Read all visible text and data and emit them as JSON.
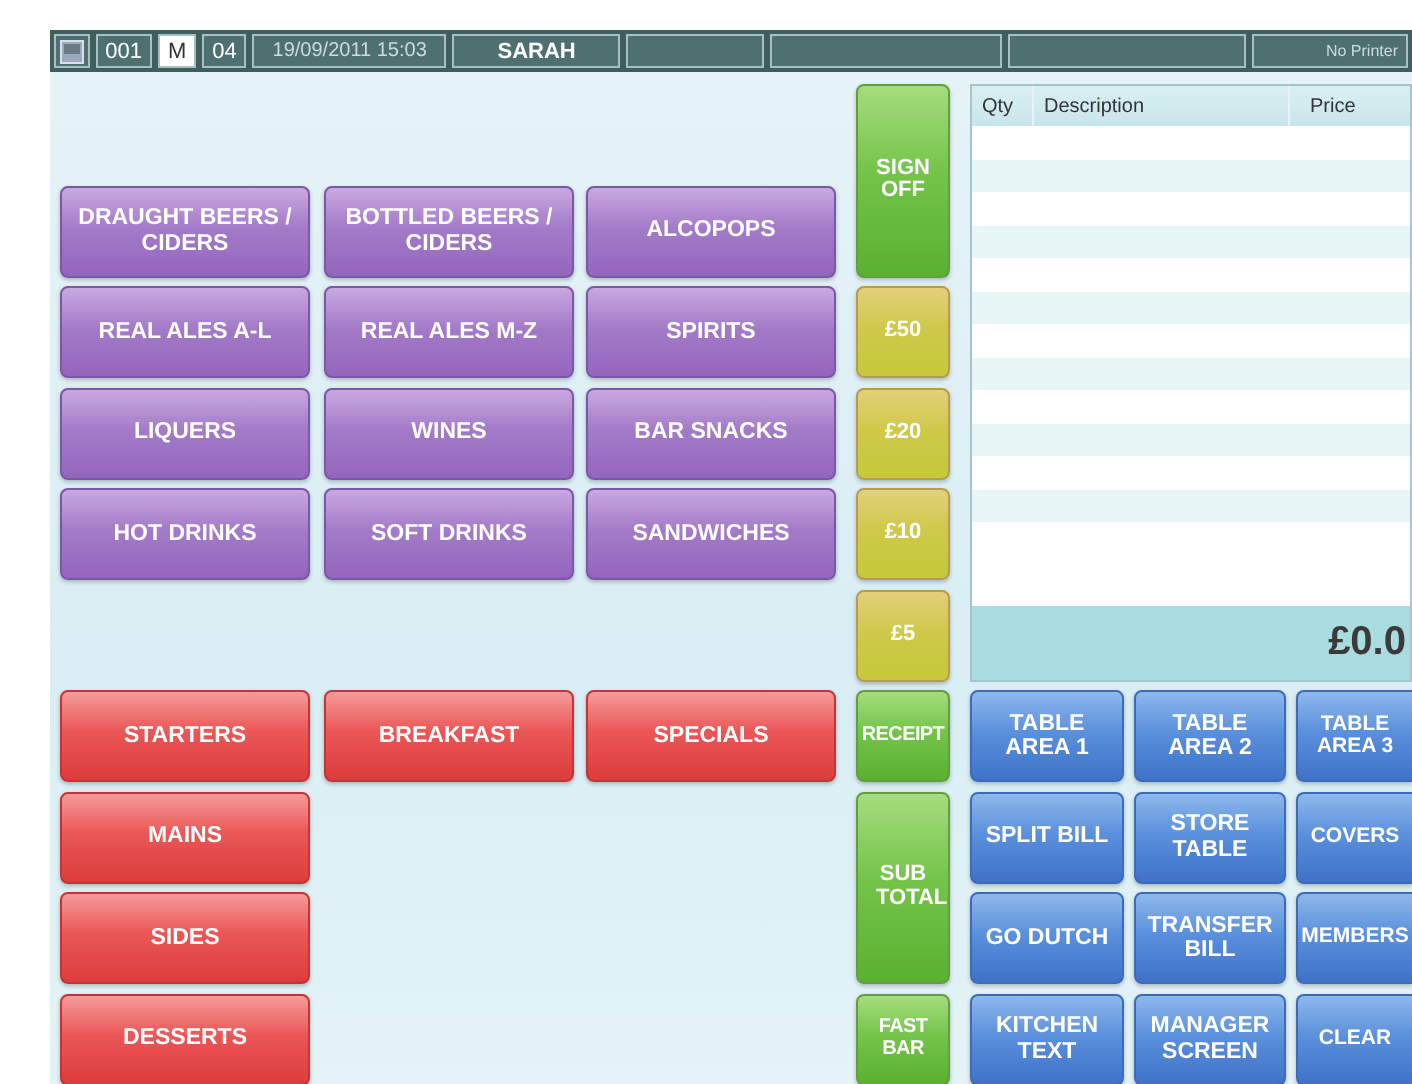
{
  "status_bar": {
    "terminal": "001",
    "mode": "M",
    "number": "04",
    "datetime": "19/09/2011 15:03",
    "user": "SARAH",
    "printer": "No Printer"
  },
  "category_rows": [
    [
      "DRAUGHT BEERS / CIDERS",
      "BOTTLED BEERS / CIDERS",
      "ALCOPOPS"
    ],
    [
      "REAL ALES A-L",
      "REAL ALES M-Z",
      "SPIRITS"
    ],
    [
      "LIQUERS",
      "WINES",
      "BAR SNACKS"
    ],
    [
      "HOT DRINKS",
      "SOFT DRINKS",
      "SANDWICHES"
    ]
  ],
  "food_rows": [
    [
      "STARTERS",
      "BREAKFAST",
      "SPECIALS"
    ],
    [
      "MAINS"
    ],
    [
      "SIDES"
    ],
    [
      "DESSERTS"
    ]
  ],
  "side_buttons": [
    {
      "label": "SIGN OFF",
      "kind": "action",
      "tall": true
    },
    {
      "label": "£50",
      "kind": "cash",
      "tall": false
    },
    {
      "label": "£20",
      "kind": "cash",
      "tall": false
    },
    {
      "label": "£10",
      "kind": "cash",
      "tall": false
    },
    {
      "label": "£5",
      "kind": "cash",
      "tall": false
    },
    {
      "label": "RECEIPT",
      "kind": "action",
      "tall": false
    },
    {
      "label": "SUB TOTAL",
      "kind": "action",
      "tall": true
    },
    {
      "label": "FAST BAR",
      "kind": "action",
      "tall": false
    }
  ],
  "receipt": {
    "columns": [
      "Qty",
      "Description",
      "Price"
    ],
    "total": "£0.0"
  },
  "function_rows": [
    [
      "TABLE AREA 1",
      "TABLE AREA 2",
      "TABLE AREA 3"
    ],
    [
      "SPLIT BILL",
      "STORE TABLE",
      "COVERS"
    ],
    [
      "GO DUTCH",
      "TRANSFER BILL",
      "MEMBERS"
    ],
    [
      "KITCHEN TEXT",
      "MANAGER SCREEN",
      "CLEAR"
    ]
  ]
}
